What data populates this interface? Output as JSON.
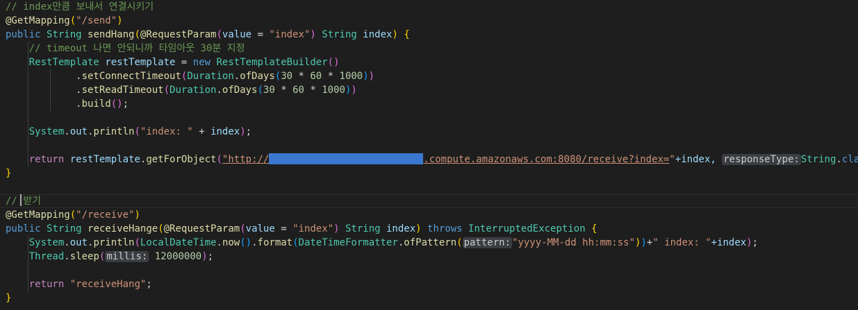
{
  "editor": {
    "line1": {
      "comment": "// index만큼 보내서 연결시키기"
    },
    "line2": {
      "annotation": "@GetMapping",
      "path": "\"/send\""
    },
    "line3": {
      "public": "public",
      "string": "String",
      "method": "sendHang",
      "annotation": "@RequestParam",
      "value": "value",
      "eq": " = ",
      "param_str": "\"index\"",
      "param_type": "String",
      "param_name": "index"
    },
    "line4": {
      "comment": "// timeout 나면 안되니까 타임아웃 30분 지정"
    },
    "line5": {
      "type": "RestTemplate",
      "var": "restTemplate",
      "eq": " = ",
      "new": "new",
      "builder": "RestTemplateBuilder"
    },
    "line6": {
      "method": "setConnectTimeout",
      "duration": "Duration",
      "ofDays": "ofDays",
      "n1": "30",
      "n2": "60",
      "n3": "1000"
    },
    "line7": {
      "method": "setReadTimeout",
      "duration": "Duration",
      "ofDays": "ofDays",
      "n1": "30",
      "n2": "60",
      "n3": "1000"
    },
    "line8": {
      "method": "build"
    },
    "line10": {
      "system": "System",
      "out": "out",
      "println": "println",
      "str": "\"index: \"",
      "plus": " + ",
      "var": "index"
    },
    "line12": {
      "return": "return",
      "var": "restTemplate",
      "method": "getForObject",
      "url_start": "\"http://",
      "url_end": ".compute.amazonaws.com:8080/receive?index=",
      "quote": "\"",
      "plus_index": "+index, ",
      "hint": "responseType:",
      "string": "String",
      "class": "class"
    },
    "line15": {
      "comment": "// 받기"
    },
    "line16": {
      "annotation": "@GetMapping",
      "path": "\"/receive\""
    },
    "line17": {
      "public": "public",
      "string": "String",
      "method": "receiveHange",
      "annotation": "@RequestParam",
      "value": "value",
      "eq": " = ",
      "param_str": "\"index\"",
      "param_type": "String",
      "param_name": "index",
      "throws": "throws",
      "exception": "InterruptedException"
    },
    "line18": {
      "system": "System",
      "out": "out",
      "println": "println",
      "ldt": "LocalDateTime",
      "now": "now",
      "format": "format",
      "dtf": "DateTimeFormatter",
      "ofPattern": "ofPattern",
      "hint": "pattern:",
      "pattern": "\"yyyy-MM-dd hh:mm:ss\"",
      "str": "\" index: \"",
      "tail": "+index"
    },
    "line19": {
      "thread": "Thread",
      "sleep": "sleep",
      "hint": "millis:",
      "num": "12000000"
    },
    "line21": {
      "return": "return",
      "str": "\"receiveHang\""
    }
  }
}
